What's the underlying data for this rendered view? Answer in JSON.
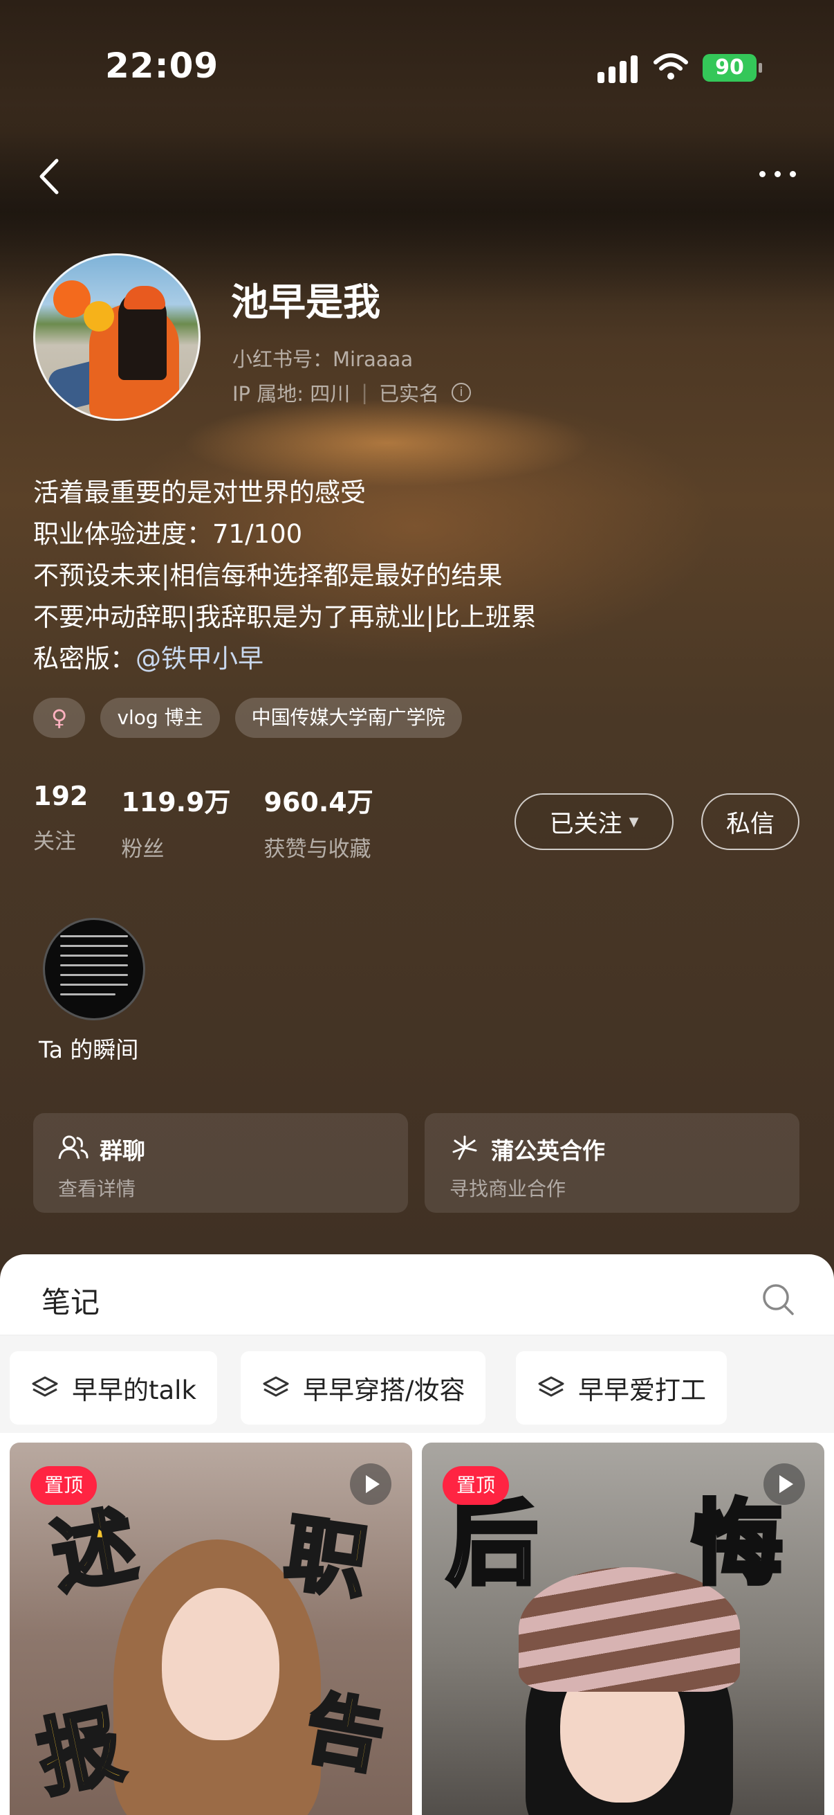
{
  "status": {
    "time": "22:09",
    "battery": "90"
  },
  "profile": {
    "name": "池早是我",
    "red_id": "小红书号：Miraaaa",
    "ip": "IP 属地: 四川",
    "verified": "已实名",
    "bio": [
      "活着最重要的是对世界的感受",
      "职业体验进度：71/100",
      "不预设未来|相信每种选择都是最好的结果",
      "不要冲动辞职|我辞职是为了再就业|比上班累"
    ],
    "bio_private_prefix": "私密版：",
    "bio_private_mention": "@铁甲小早",
    "tags": [
      "♀",
      "vlog 博主",
      "中国传媒大学南广学院"
    ]
  },
  "stats": [
    {
      "num": "192",
      "label": "关注"
    },
    {
      "num": "119.9万",
      "label": "粉丝"
    },
    {
      "num": "960.4万",
      "label": "获赞与收藏"
    }
  ],
  "actions": {
    "follow": "已关注",
    "message": "私信"
  },
  "moment": {
    "label": "Ta 的瞬间"
  },
  "cards": [
    {
      "title": "群聊",
      "sub": "查看详情",
      "icon": "group-icon"
    },
    {
      "title": "蒲公英合作",
      "sub": "寻找商业合作",
      "icon": "dandelion-icon"
    }
  ],
  "notes": {
    "title": "笔记",
    "collections": [
      "早早的talk",
      "早早穿搭/妆容",
      "早早爱打工"
    ],
    "posts": [
      {
        "badge": "置顶",
        "chars": [
          "述",
          "职",
          "报",
          "告"
        ]
      },
      {
        "badge": "置顶",
        "chars": [
          "后",
          "悔"
        ]
      }
    ]
  },
  "colors": {
    "accent": "#ff2442",
    "battery": "#34c759"
  }
}
